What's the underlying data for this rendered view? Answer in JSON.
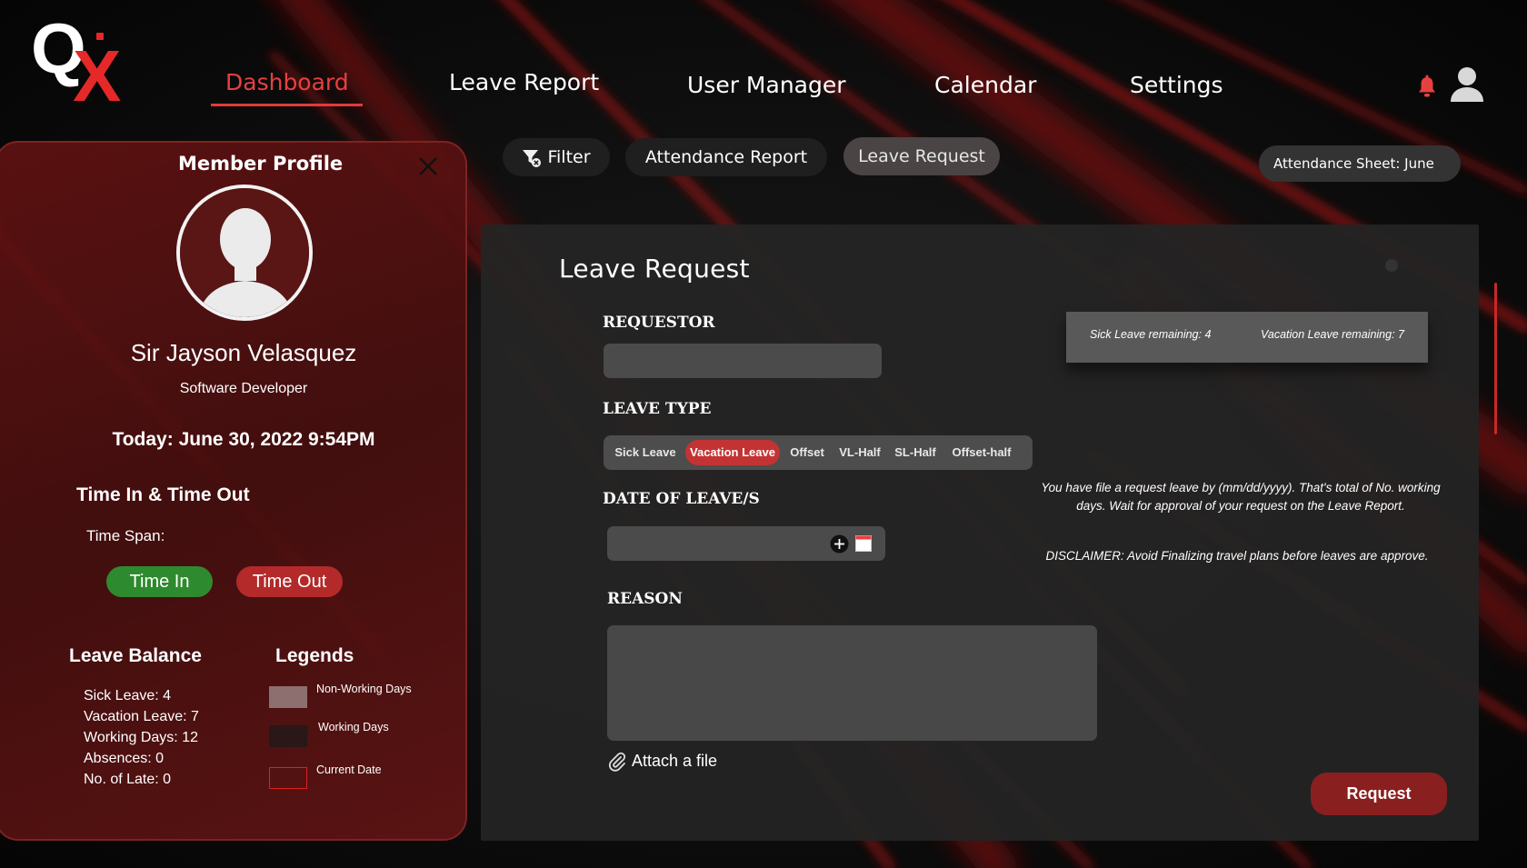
{
  "logo": {
    "letter_q": "Q",
    "letter_x": "X"
  },
  "nav": {
    "items": [
      {
        "label": "Dashboard",
        "active": true
      },
      {
        "label": "Leave Report"
      },
      {
        "label": "User Manager"
      },
      {
        "label": "Calendar"
      },
      {
        "label": "Settings"
      }
    ],
    "icons": [
      "bell-icon",
      "user-icon"
    ],
    "accent_color": "#e23b3b"
  },
  "profile": {
    "title": "Member Profile",
    "name": "Sir Jayson Velasquez",
    "role": "Software Developer",
    "today": "Today: June 30, 2022 9:54PM",
    "time_section_title": "Time In & Time Out",
    "time_span_label": "Time Span:",
    "time_in_label": "Time In",
    "time_out_label": "Time Out",
    "leave_balance_title": "Leave Balance",
    "leave_balance": [
      "Sick Leave: 4",
      "Vacation Leave: 7",
      "Working Days: 12",
      "Absences: 0",
      "No. of Late: 0"
    ],
    "legends_title": "Legends",
    "legends": [
      {
        "label": "Non-Working Days",
        "color": "#8e6f6f"
      },
      {
        "label": "Working Days",
        "color": "#2a1818"
      },
      {
        "label": "Current Date",
        "color": "#e01f1f"
      }
    ]
  },
  "subnav": {
    "filter_label": "Filter",
    "attendance_report_label": "Attendance Report",
    "leave_request_label": "Leave Request",
    "attendance_sheet_label": "Attendance Sheet:  June"
  },
  "form": {
    "title": "Leave Request",
    "requestor_label": "REQUESTOR",
    "requestor_value": "",
    "leave_type_label": "LEAVE TYPE",
    "leave_types": [
      {
        "label": "Sick Leave"
      },
      {
        "label": "Vacation Leave",
        "selected": true
      },
      {
        "label": "Offset"
      },
      {
        "label": "VL-Half"
      },
      {
        "label": "SL-Half"
      },
      {
        "label": "Offset-half"
      }
    ],
    "date_label": "DATE OF LEAVE/S",
    "reason_label": "REASON",
    "attach_label": "Attach a file",
    "sick_remaining": "Sick Leave remaining: 4",
    "vacation_remaining": "Vacation Leave remaining: 7",
    "info_text": "You have file a request leave by (mm/dd/yyyy). That's total  of No. working days. Wait for approval of your request on the Leave Report.",
    "disclaimer": "DISCLAIMER: Avoid Finalizing travel plans before leaves are approve.",
    "request_button": "Request"
  }
}
